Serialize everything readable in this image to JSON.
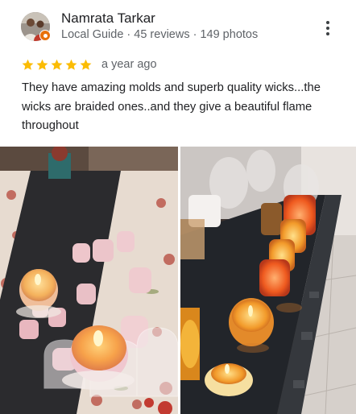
{
  "reviewer": {
    "name": "Namrata Tarkar",
    "meta": "Local Guide · 45 reviews · 149 photos",
    "avatar_icon": "reviewer-avatar-photo",
    "badge_icon": "local-guide-badge-icon"
  },
  "review": {
    "rating": 5,
    "max_rating": 5,
    "date": "a year ago",
    "text": "They have amazing molds and superb quality wicks...the wicks are braided ones..and they give a beautiful flame throughout"
  },
  "more_icon": "more-vert-icon",
  "photos": [
    {
      "icon": "review-photo-candles-table"
    },
    {
      "icon": "review-photo-candles-shelf"
    }
  ],
  "colors": {
    "star": "#fbbc04",
    "text_primary": "#202124",
    "text_secondary": "#5f6368",
    "badge": "#e8710a"
  }
}
